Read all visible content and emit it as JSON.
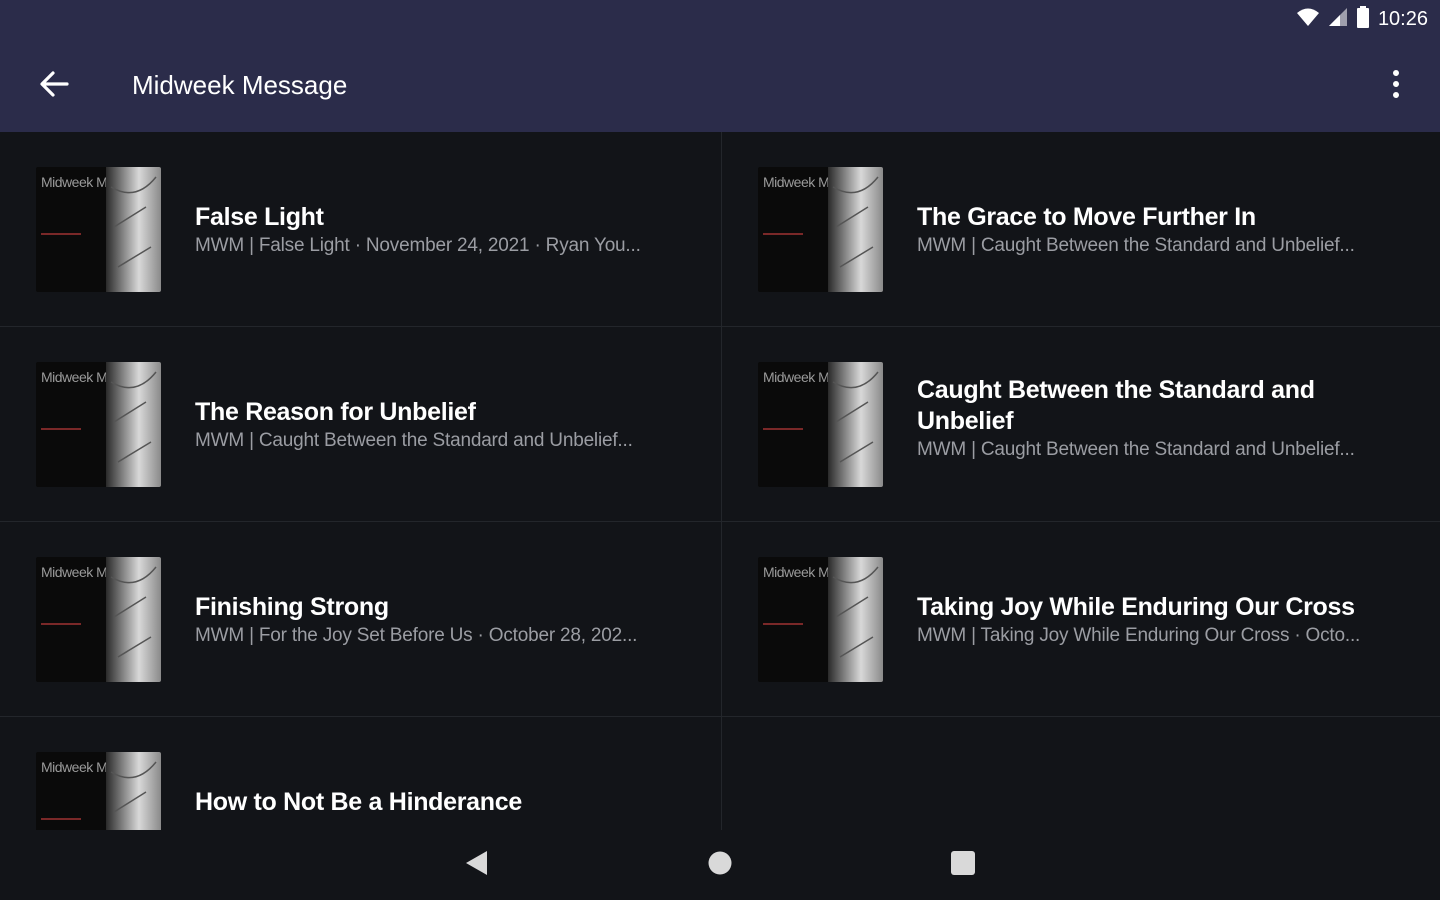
{
  "status_bar": {
    "time": "10:26",
    "icons": [
      "wifi-icon",
      "cellular-signal-icon",
      "battery-icon"
    ]
  },
  "app_bar": {
    "title": "Midweek Message",
    "back_icon": "arrow-back-icon",
    "menu_icon": "more-vert-icon"
  },
  "episodes": [
    {
      "title": "False Light",
      "subtitle": "MWM | False Light · November 24, 2021 · Ryan You...",
      "thumb_text": "Midweek Message"
    },
    {
      "title": "The Grace to Move Further In",
      "subtitle": "MWM | Caught Between the Standard and Unbelief...",
      "thumb_text": "Midweek Message"
    },
    {
      "title": "The Reason for Unbelief",
      "subtitle": "MWM | Caught Between the Standard and Unbelief...",
      "thumb_text": "Midweek Message"
    },
    {
      "title": "Caught Between the Standard and Unbelief",
      "subtitle": "MWM | Caught Between the Standard and Unbelief...",
      "thumb_text": "Midweek Message"
    },
    {
      "title": "Finishing Strong",
      "subtitle": "MWM | For the Joy Set Before Us · October 28, 202...",
      "thumb_text": "Midweek Message"
    },
    {
      "title": "Taking Joy While Enduring Our Cross",
      "subtitle": "MWM | Taking Joy While Enduring Our Cross · Octo...",
      "thumb_text": "Midweek Message"
    },
    {
      "title": "How to Not Be a Hinderance",
      "subtitle": "",
      "thumb_text": "Midweek Message"
    }
  ],
  "nav_bar": {
    "icons": [
      "nav-back-triangle-icon",
      "nav-home-circle-icon",
      "nav-recents-square-icon"
    ]
  },
  "colors": {
    "app_bar_bg": "#2b2c4a",
    "background": "#121418",
    "subtitle_text": "#9b9da3"
  }
}
